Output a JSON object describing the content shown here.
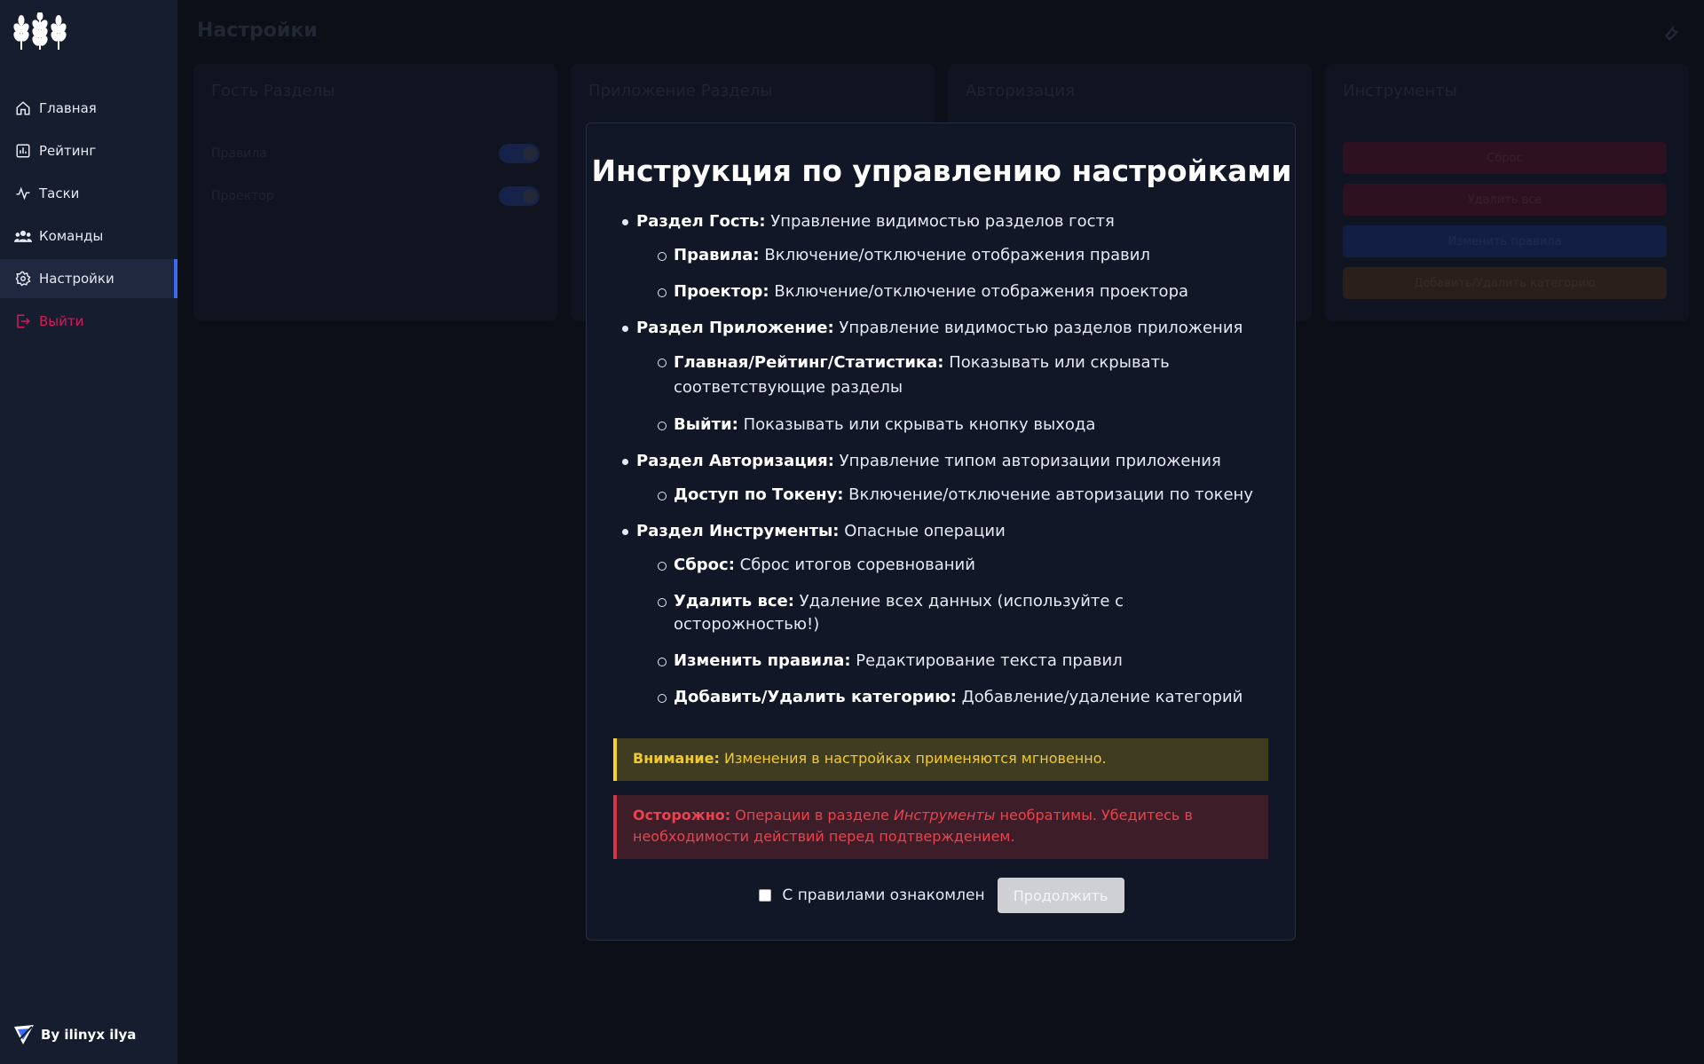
{
  "sidebar": {
    "items": [
      {
        "label": "Главная",
        "icon": "home-icon"
      },
      {
        "label": "Рейтинг",
        "icon": "chart-icon"
      },
      {
        "label": "Таски",
        "icon": "activity-icon"
      },
      {
        "label": "Команды",
        "icon": "users-icon"
      },
      {
        "label": "Настройки",
        "icon": "gear-icon",
        "active": true
      },
      {
        "label": "Выйти",
        "icon": "logout-icon"
      }
    ],
    "footer": "By ilinyx ilya"
  },
  "main": {
    "title": "Настройки",
    "cards": [
      {
        "title": "Гость Разделы",
        "rows": [
          "Правила",
          "Проектор"
        ]
      },
      {
        "title": "Приложение Разделы"
      },
      {
        "title": "Авторизация"
      },
      {
        "title": "Инструменты",
        "buttons": [
          "Сброс",
          "Удалить все",
          "Изменить правила",
          "Добавить/Удалить категорию"
        ]
      }
    ]
  },
  "modal": {
    "title": "Инструкция по управлению настройками",
    "sections": [
      {
        "head": "Раздел Гость:",
        "text": " Управление видимостью разделов гостя",
        "items": [
          {
            "head": "Правила:",
            "text": " Включение/отключение отображения правил"
          },
          {
            "head": "Проектор:",
            "text": " Включение/отключение отображения проектора"
          }
        ]
      },
      {
        "head": "Раздел Приложение:",
        "text": " Управление видимостью разделов приложения",
        "items": [
          {
            "head": "Главная/Рейтинг/Статистика:",
            "text": " Показывать или скрывать соответствующие разделы"
          },
          {
            "head": "Выйти:",
            "text": " Показывать или скрывать кнопку выхода"
          }
        ]
      },
      {
        "head": "Раздел Авторизация:",
        "text": " Управление типом авторизации приложения",
        "items": [
          {
            "head": "Доступ по Токену:",
            "text": " Включение/отключение авторизации по токену"
          }
        ]
      },
      {
        "head": "Раздел Инструменты:",
        "text": " Опасные операции",
        "items": [
          {
            "head": "Сброс:",
            "text": " Сброс итогов соревнований"
          },
          {
            "head": "Удалить все:",
            "text": " Удаление всех данных (используйте с осторожностью!)"
          },
          {
            "head": "Изменить правила:",
            "text": " Редактирование текста правил"
          },
          {
            "head": "Добавить/Удалить категорию:",
            "text": " Добавление/удаление категорий"
          }
        ]
      }
    ],
    "warning": {
      "head": "Внимание:",
      "text": " Изменения в настройках применяются мгновенно."
    },
    "danger": {
      "head": "Осторожно:",
      "pre": " Операции в разделе ",
      "em": "Инструменты",
      "post": " необратимы. Убедитесь в необходимости действий перед подтверждением."
    },
    "checkbox_label": "С правилами ознакомлен",
    "checkbox_checked": false,
    "continue_label": "Продолжить"
  },
  "colors": {
    "accent": "#3b6bf0",
    "logout": "#d11d5a",
    "warning": "#f6d12a",
    "danger": "#d83342"
  }
}
